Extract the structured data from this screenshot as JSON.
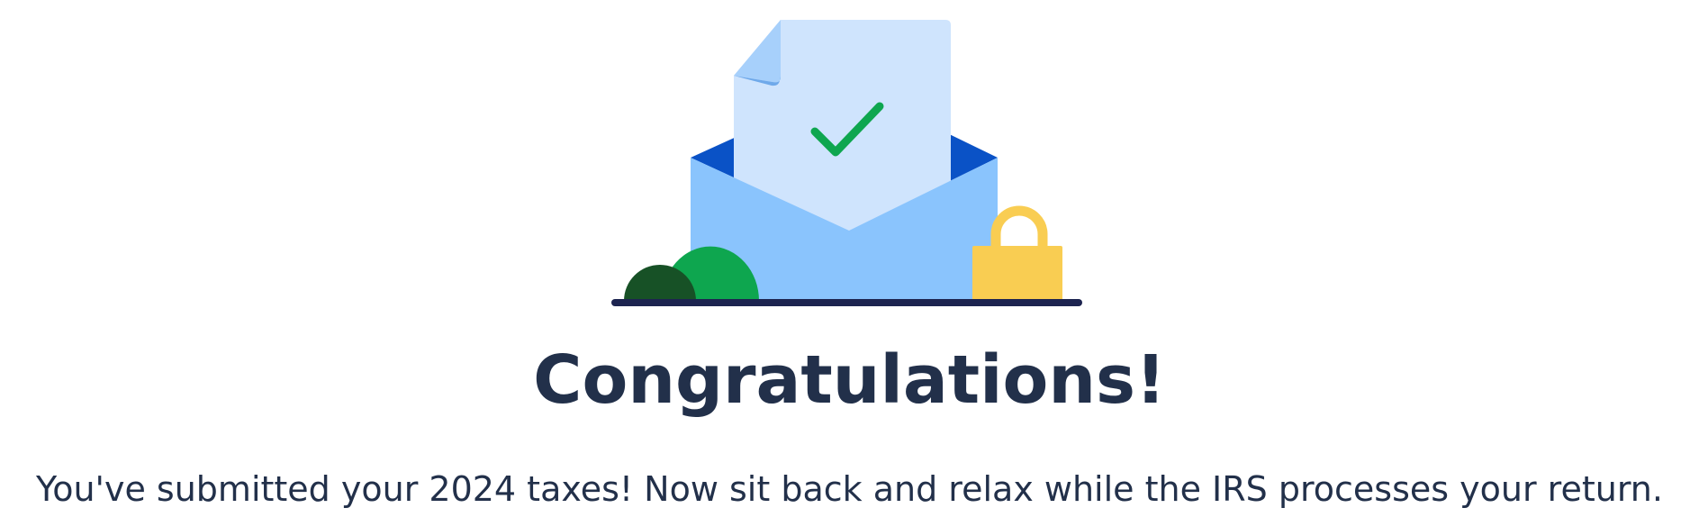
{
  "illustration": {
    "icons": [
      "envelope-icon",
      "document-icon",
      "checkmark-icon",
      "padlock-icon",
      "bush-icon"
    ],
    "colors": {
      "envelope_body": "#8ac4fd",
      "envelope_inner": "#0a52c6",
      "document": "#cfe4fd",
      "document_fold": "#a7d0fb",
      "checkmark": "#0ea64f",
      "padlock": "#f9cd52",
      "bush_dark": "#175126",
      "bush_light": "#0ea64f",
      "ground": "#1d2450"
    }
  },
  "heading": "Congratulations!",
  "message": "You've submitted your 2024 taxes! Now sit back and relax while the IRS processes your return.",
  "text_color": "#22304a"
}
